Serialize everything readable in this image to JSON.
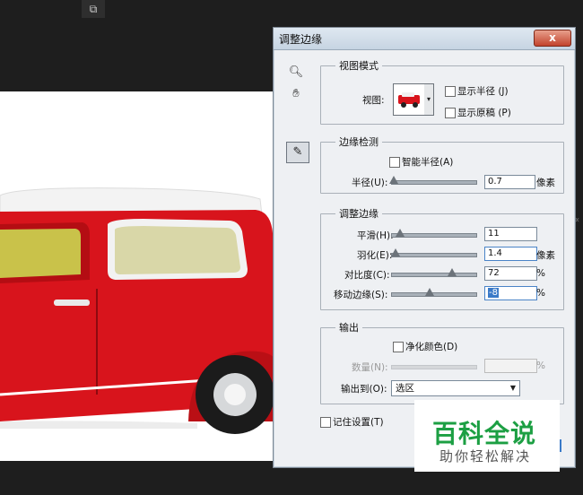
{
  "dialog": {
    "title": "调整边缘",
    "close_label": "x"
  },
  "view_mode": {
    "group_label": "视图模式",
    "view_label": "视图:",
    "show_radius_label": "显示半径 (J)",
    "show_original_label": "显示原稿 (P)"
  },
  "edge_detection": {
    "group_label": "边缘检测",
    "smart_radius_label": "智能半径(A)",
    "radius_label": "半径(U):",
    "radius_value": "0.7",
    "radius_unit": "像素",
    "radius_fraction": 0.03
  },
  "adjust_edge": {
    "group_label": "调整边缘",
    "smooth_label": "平滑(H):",
    "smooth_value": "11",
    "smooth_fraction": 0.11,
    "feather_label": "羽化(E):",
    "feather_value": "1.4",
    "feather_unit": "像素",
    "feather_fraction": 0.05,
    "contrast_label": "对比度(C):",
    "contrast_value": "72",
    "contrast_unit": "%",
    "contrast_fraction": 0.72,
    "shift_label": "移动边缘(S):",
    "shift_value": "-8",
    "shift_unit": "%",
    "shift_fraction": 0.46
  },
  "output": {
    "group_label": "输出",
    "decontaminate_label": "净化颜色(D)",
    "amount_label": "数量(N):",
    "amount_unit": "%",
    "output_to_label": "输出到(O):",
    "output_to_value": "选区"
  },
  "remember_label": "记住设置(T)",
  "watermark": {
    "title": "百科全说",
    "subtitle": "助你轻松解决"
  },
  "icons": {
    "zoom": "magnifier-icon",
    "hand": "hand-icon",
    "brush": "refine-brush-icon",
    "top": "panel-icon"
  },
  "colors": {
    "car_red": "#d8141c",
    "watermark_green": "#1c9f43",
    "dialog_bg": "#eef0f3"
  }
}
